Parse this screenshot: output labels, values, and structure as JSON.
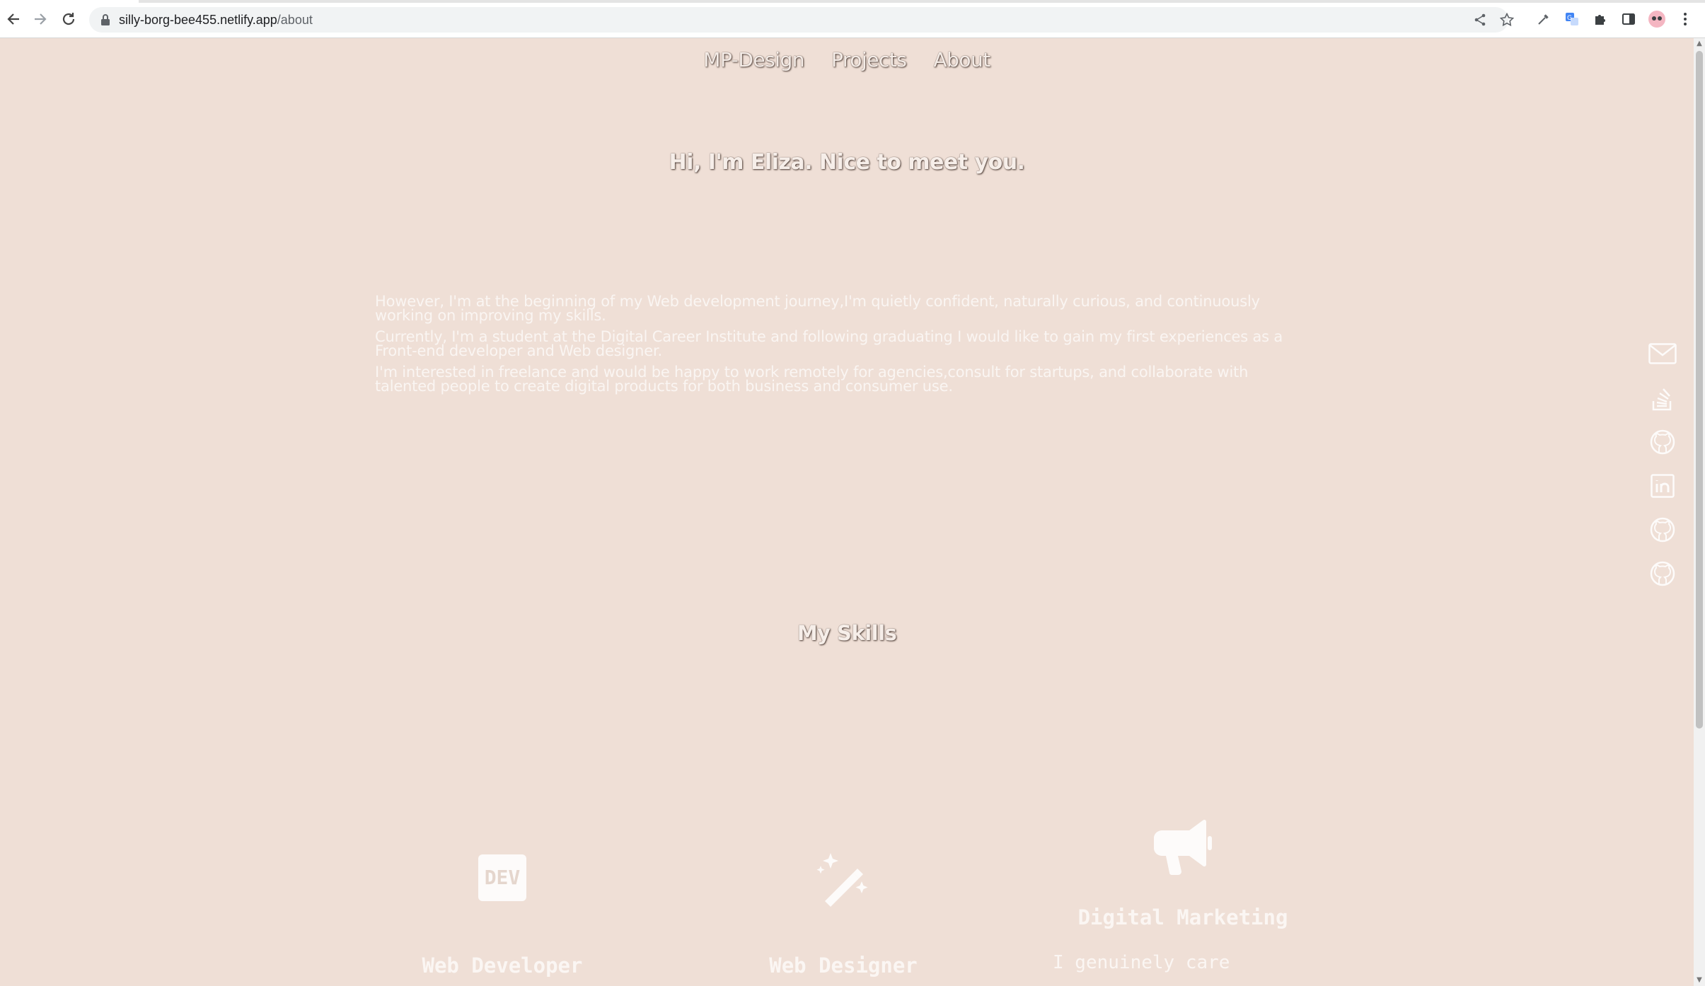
{
  "browser": {
    "url_host": "silly-borg-bee455.netlify.app",
    "url_path": "/about",
    "back_icon": "arrow-left-icon",
    "forward_icon": "arrow-right-icon",
    "reload_icon": "reload-icon"
  },
  "nav": {
    "items": [
      {
        "label": "MP-Design"
      },
      {
        "label": "Projects"
      },
      {
        "label": "About"
      }
    ]
  },
  "hero": {
    "title": "Hi, I'm Eliza. Nice to meet you."
  },
  "about": {
    "paragraphs": [
      "However, I'm at the beginning of my Web development journey,I'm quietly confident, naturally curious, and continuously working on improving my skills.",
      "Currently, I'm a student at the Digital Career Institute and following graduating I would like to gain my first experiences as a Front-end developer and Web designer.",
      "I'm interested in freelance and would be happy to work remotely for agencies,consult for startups, and collaborate with talented people to create digital products for both business and consumer use."
    ]
  },
  "skills": {
    "title": "My Skills",
    "cards": [
      {
        "title": "Web Developer",
        "icon": "dev-logo-icon"
      },
      {
        "title": "Web Designer",
        "icon": "magic-wand-icon"
      },
      {
        "title": "Digital Marketing",
        "icon": "megaphone-icon",
        "description": "I genuinely care"
      }
    ]
  },
  "social": [
    {
      "icon": "envelope-icon"
    },
    {
      "icon": "stack-overflow-icon"
    },
    {
      "icon": "github-icon"
    },
    {
      "icon": "linkedin-icon"
    },
    {
      "icon": "github-icon"
    },
    {
      "icon": "github-icon"
    }
  ],
  "colors": {
    "background": "#efdfd6",
    "text_light": "#f6eee9",
    "shadow": "#4a3a33"
  }
}
